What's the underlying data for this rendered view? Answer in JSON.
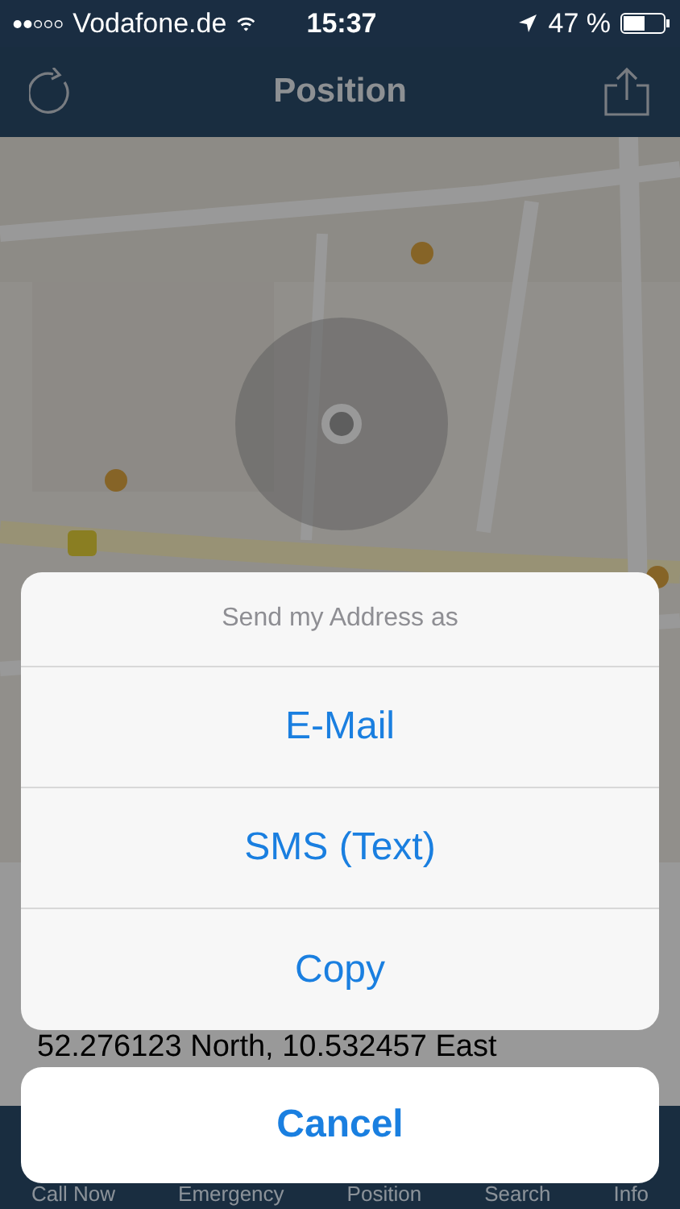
{
  "status_bar": {
    "carrier": "Vodafone.de",
    "time": "15:37",
    "battery": "47 %"
  },
  "nav_bar": {
    "title": "Position"
  },
  "coordinates": "52.276123 North, 10.532457 East",
  "action_sheet": {
    "title": "Send my Address as",
    "actions": [
      "E-Mail",
      "SMS (Text)",
      "Copy"
    ],
    "cancel": "Cancel"
  },
  "tab_bar": {
    "items": [
      {
        "label": "Call Now"
      },
      {
        "label": "Emergency"
      },
      {
        "label": "Position"
      },
      {
        "label": "Search"
      },
      {
        "label": "Info"
      }
    ]
  }
}
